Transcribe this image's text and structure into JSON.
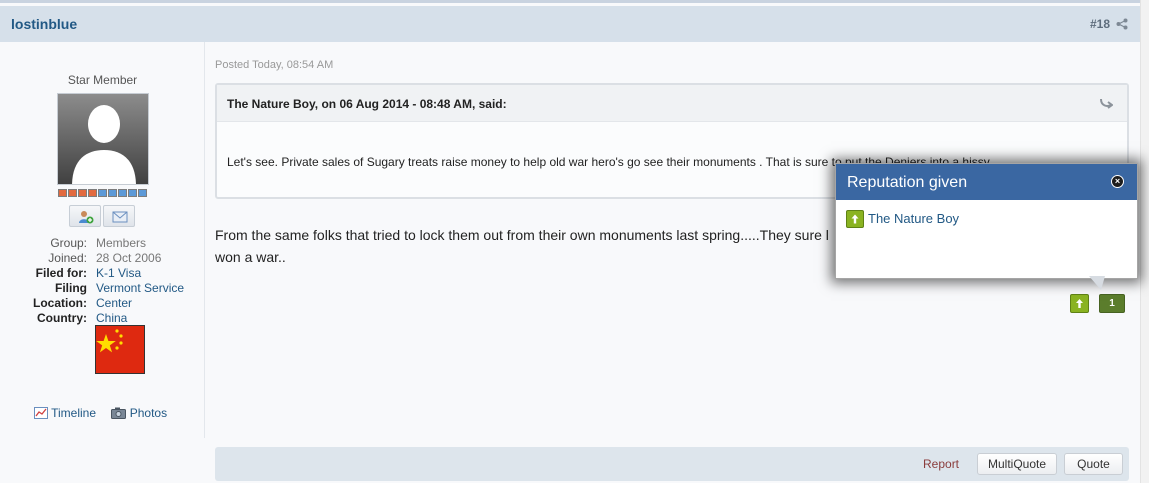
{
  "post": {
    "author": "lostinblue",
    "number": "#18",
    "posted": "Posted Today, 08:54 AM"
  },
  "author_panel": {
    "rank": "Star Member",
    "reputation_pips": {
      "filled": 4,
      "total": 9
    },
    "info": [
      {
        "label": "Group:",
        "value": "Members",
        "bold": false,
        "link": false
      },
      {
        "label": "Joined:",
        "value": "28 Oct 2006",
        "bold": false,
        "link": false
      },
      {
        "label": "Filed for:",
        "value": "K-1 Visa",
        "bold": true,
        "link": true
      },
      {
        "label": "Filing",
        "value": "Vermont Service",
        "bold": true,
        "link": true
      },
      {
        "label": "Location:",
        "value": "Center",
        "bold": true,
        "link": true
      },
      {
        "label": "Country:",
        "value": "China",
        "bold": true,
        "link": true
      }
    ],
    "timeline_label": "Timeline",
    "photos_label": "Photos"
  },
  "quote": {
    "citation": "The Nature Boy, on 06 Aug 2014 - 08:48 AM, said:",
    "text": "Let's see. Private sales  of Sugary treats raise money to help old war hero's go see their monuments .  That is sure to put the Deniers into a hissy"
  },
  "body": {
    "line1": "From the same folks that tried to lock them out from their own monuments last spring.....They sure l",
    "line2": "won a war.."
  },
  "reputation": {
    "count": "1"
  },
  "controls": {
    "report": "Report",
    "multiquote": "MultiQuote",
    "quote": "Quote"
  },
  "popup": {
    "title": "Reputation given",
    "close": "×",
    "user": "The Nature Boy"
  },
  "colors": {
    "header_bg": "#d6e0ea",
    "link": "#225985",
    "popup_head": "#3a67a2",
    "rep_green": "#8ab321"
  }
}
